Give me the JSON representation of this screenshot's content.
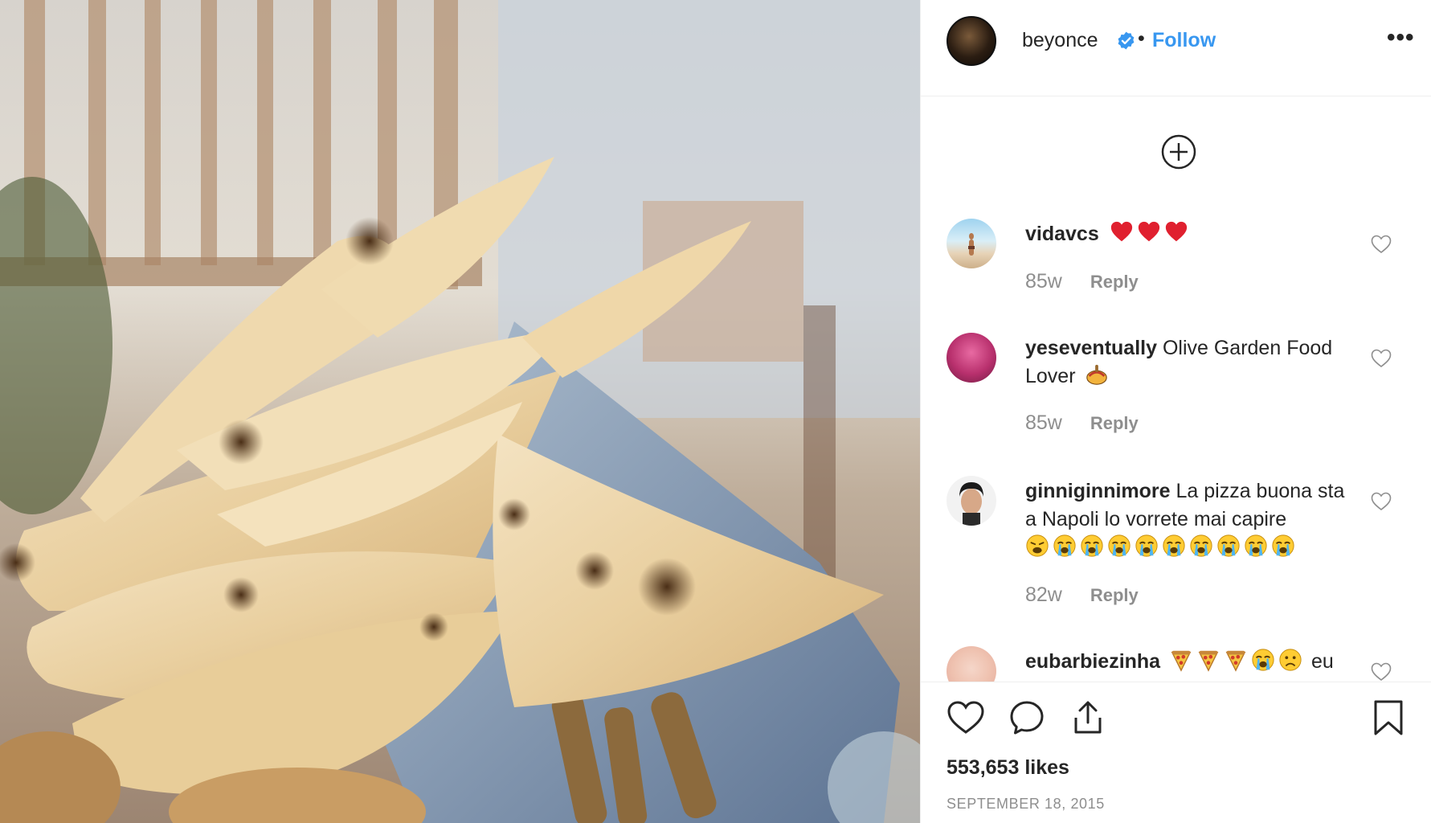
{
  "photo": {
    "alt": ""
  },
  "header": {
    "username": "beyonce",
    "verified": true,
    "separator": "•",
    "follow_label": "Follow",
    "more_label": "•••"
  },
  "comments": [
    {
      "username": "vidavcs",
      "text": "",
      "emoji": [
        "red-heart",
        "red-heart",
        "red-heart"
      ],
      "time": "85w",
      "reply_label": "Reply"
    },
    {
      "username": "yeseventually",
      "text": "Olive Garden Food Lover",
      "emoji": [
        "spaghetti"
      ],
      "time": "85w",
      "reply_label": "Reply"
    },
    {
      "username": "ginniginnimore",
      "text": "La pizza buona sta a Napoli lo vorrete mai capire",
      "emoji": [
        "weary-face",
        "crying-face",
        "crying-face",
        "crying-face",
        "crying-face",
        "crying-face",
        "crying-face",
        "crying-face",
        "crying-face",
        "crying-face"
      ],
      "time": "82w",
      "reply_label": "Reply"
    },
    {
      "username": "eubarbiezinha",
      "text": "eu",
      "emoji": [
        "pizza",
        "pizza",
        "pizza",
        "crying-face",
        "frowning-face"
      ]
    }
  ],
  "actions": {
    "likes": "553,653 likes",
    "date": "SEPTEMBER 18, 2015"
  },
  "colors": {
    "link": "#3897f0",
    "text": "#262626",
    "muted": "#8e8e8e",
    "border": "#efefef"
  }
}
